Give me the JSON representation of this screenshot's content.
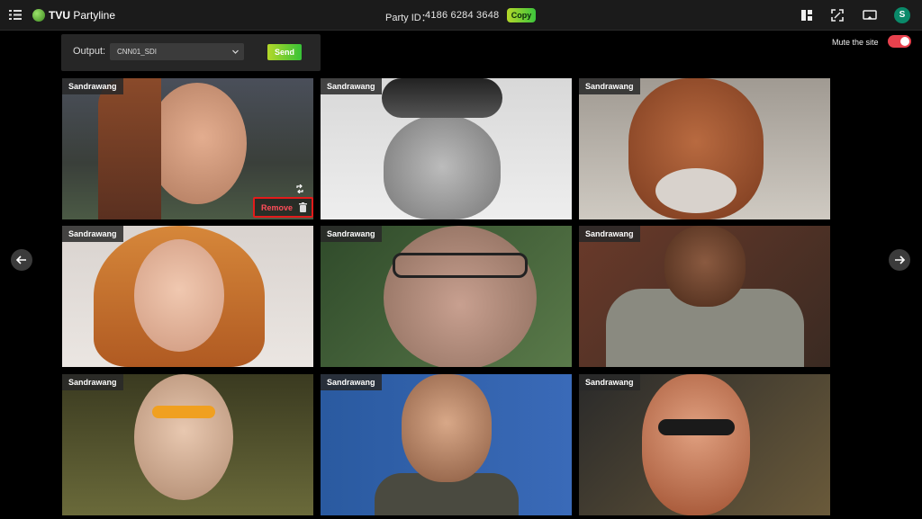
{
  "header": {
    "app_name_bold": "TVU",
    "app_name_rest": " Partyline",
    "party_label": "Party ID：",
    "party_id": "4186 6284 3648",
    "copy_label": "Copy",
    "user_initial": "S"
  },
  "output": {
    "label": "Output:",
    "selected": "CNN01_SDI",
    "send_label": "Send"
  },
  "mute": {
    "label": "Mute the site",
    "enabled": true
  },
  "tiles": [
    {
      "name": "Sandrawang",
      "hover_action": "Remove"
    },
    {
      "name": "Sandrawang"
    },
    {
      "name": "Sandrawang"
    },
    {
      "name": "Sandrawang"
    },
    {
      "name": "Sandrawang"
    },
    {
      "name": "Sandrawang"
    },
    {
      "name": "Sandrawang"
    },
    {
      "name": "Sandrawang"
    },
    {
      "name": "Sandrawang"
    }
  ],
  "icons": {
    "menu": "menu-icon",
    "layout": "layout-icon",
    "expand": "expand-icon",
    "screen": "screen-icon",
    "prev": "arrow-left-icon",
    "next": "arrow-right-icon",
    "swap": "swap-icon",
    "trash": "trash-icon"
  },
  "colors": {
    "accent_green": "#3cc43c",
    "toggle_on": "#e8414d",
    "highlight_red": "#e31b1b"
  }
}
